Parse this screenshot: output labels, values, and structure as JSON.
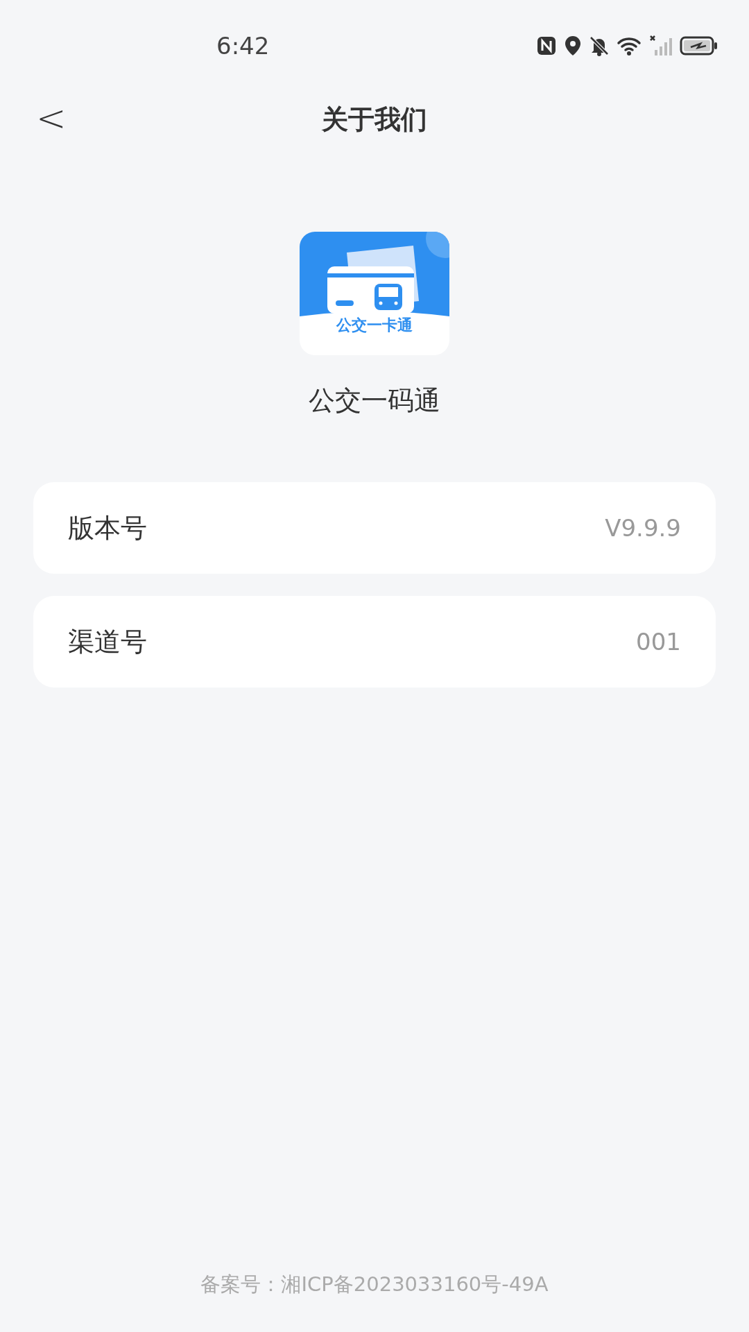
{
  "status_bar": {
    "time": "6:42"
  },
  "header": {
    "back": "<",
    "title": "关于我们"
  },
  "app": {
    "logo_text": "公交一卡通",
    "name": "公交一码通"
  },
  "info_rows": [
    {
      "label": "版本号",
      "value": "V9.9.9"
    },
    {
      "label": "渠道号",
      "value": "001"
    }
  ],
  "footer": {
    "record": "备案号：湘ICP备2023033160号-49A"
  }
}
